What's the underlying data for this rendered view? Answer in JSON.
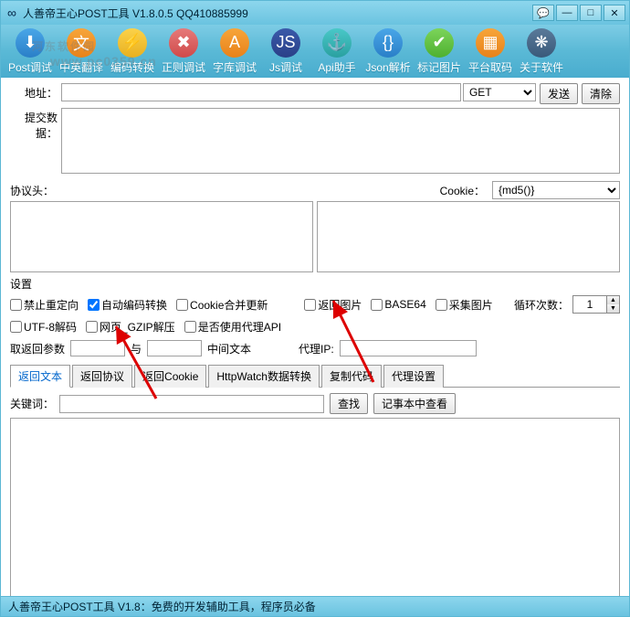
{
  "window": {
    "title": "人善帝王心POST工具 V1.8.0.5 QQ410885999"
  },
  "toolbar": [
    {
      "label": "Post调试",
      "icon": "post",
      "color": "ico-blue"
    },
    {
      "label": "中英翻译",
      "icon": "translate",
      "color": "ico-orange"
    },
    {
      "label": "编码转换",
      "icon": "encode",
      "color": "ico-yellow"
    },
    {
      "label": "正则调试",
      "icon": "regex",
      "color": "ico-red"
    },
    {
      "label": "字库调试",
      "icon": "font",
      "color": "ico-orange"
    },
    {
      "label": "Js调试",
      "icon": "js",
      "color": "ico-navy"
    },
    {
      "label": "Api助手",
      "icon": "api",
      "color": "ico-teal"
    },
    {
      "label": "Json解析",
      "icon": "json",
      "color": "ico-blue"
    },
    {
      "label": "标记图片",
      "icon": "mark",
      "color": "ico-green"
    },
    {
      "label": "平台取码",
      "icon": "code",
      "color": "ico-orange"
    },
    {
      "label": "关于软件",
      "icon": "about",
      "color": "ico-dark"
    }
  ],
  "labels": {
    "address": "地址：",
    "submit_data": "提交数据：",
    "headers": "协议头：",
    "cookie": "Cookie：",
    "settings": "设置",
    "params_ret": "取返回参数",
    "and": "与",
    "mid_text": "中间文本",
    "proxy_ip": "代理IP:",
    "loop_count": "循环次数：",
    "keyword": "关键词："
  },
  "method": {
    "selected": "GET"
  },
  "md5": {
    "selected": "{md5()}"
  },
  "buttons": {
    "send": "发送",
    "clear": "清除",
    "find": "查找",
    "notepad": "记事本中查看"
  },
  "options": {
    "no_redirect": "禁止重定向",
    "auto_encode": "自动编码转换",
    "cookie_merge": "Cookie合并更新",
    "ret_image": "返回图片",
    "base64": "BASE64",
    "collect_img": "采集图片",
    "utf8_decode": "UTF-8解码",
    "gzip": "网页_GZIP解压",
    "use_proxy": "是否使用代理API"
  },
  "loop_value": "1",
  "tabs": [
    "返回文本",
    "返回协议",
    "返回Cookie",
    "HttpWatch数据转换",
    "复制代码",
    "代理设置"
  ],
  "statusbar": "人善帝王心POST工具 V1.8：免费的开发辅助工具，程序员必备",
  "watermark": {
    "main": "河东软件园",
    "sub": "www.pc0359.cn"
  }
}
